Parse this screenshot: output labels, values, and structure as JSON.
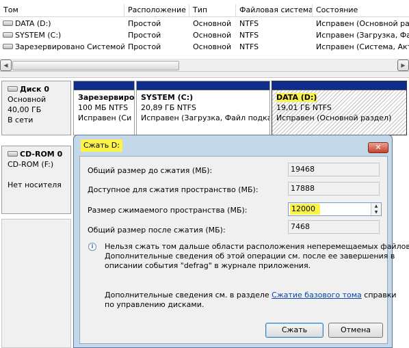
{
  "volume_list": {
    "columns": [
      "Том",
      "Расположение",
      "Тип",
      "Файловая система",
      "Состояние"
    ],
    "rows": [
      {
        "name": "DATA (D:)",
        "location": "Простой",
        "type": "Основной",
        "fs": "NTFS",
        "status": "Исправен (Основной раз"
      },
      {
        "name": "SYSTEM (C:)",
        "location": "Простой",
        "type": "Основной",
        "fs": "NTFS",
        "status": "Исправен (Загрузка, Фа"
      },
      {
        "name": "Зарезервировано Системой",
        "location": "Простой",
        "type": "Основной",
        "fs": "NTFS",
        "status": "Исправен (Система, Акт"
      }
    ]
  },
  "scroll": {
    "left": "◀",
    "right": "▶"
  },
  "disk0": {
    "name": "Диск 0",
    "kind": "Основной",
    "size": "40,00 ГБ",
    "state": "В сети",
    "partitions": [
      {
        "name": "Зарезервиро",
        "info": "100 МБ NTFS",
        "status": "Исправен (Си"
      },
      {
        "name": "SYSTEM  (C:)",
        "info": "20,89 ГБ NTFS",
        "status": "Исправен (Загрузка, Файл подкач"
      },
      {
        "name": "DATA  (D:)",
        "info": "19,01 ГБ NTFS",
        "status": "Исправен (Основной раздел)"
      }
    ]
  },
  "cdrom0": {
    "name": "CD-ROM 0",
    "drive": "CD-ROM (F:)",
    "state": "Нет носителя"
  },
  "dialog": {
    "title": "Сжать D:",
    "close": "✕",
    "total_before_label": "Общий размер до сжатия (МБ):",
    "total_before_value": "19468",
    "available_label": "Доступное для сжатия пространство (МБ):",
    "available_value": "17888",
    "shrink_label": "Размер сжимаемого пространства (МБ):",
    "shrink_value": "12000",
    "total_after_label": "Общий размер после сжатия (МБ):",
    "total_after_value": "7468",
    "info_icon": "i",
    "note1_line1": "Нельзя сжать том дальше области расположения неперемещаемых файлов.",
    "note1_line2": "Дополнительные сведения об этой операции см. после ее завершения в",
    "note1_line3": "описании события \"defrag\" в журнале приложения.",
    "note2_before": "Дополнительные сведения см. в разделе ",
    "note2_link": "Сжатие базового тома",
    "note2_after": " справки",
    "note2_line2": "по управлению дисками.",
    "ok": "Сжать",
    "cancel": "Отмена"
  }
}
